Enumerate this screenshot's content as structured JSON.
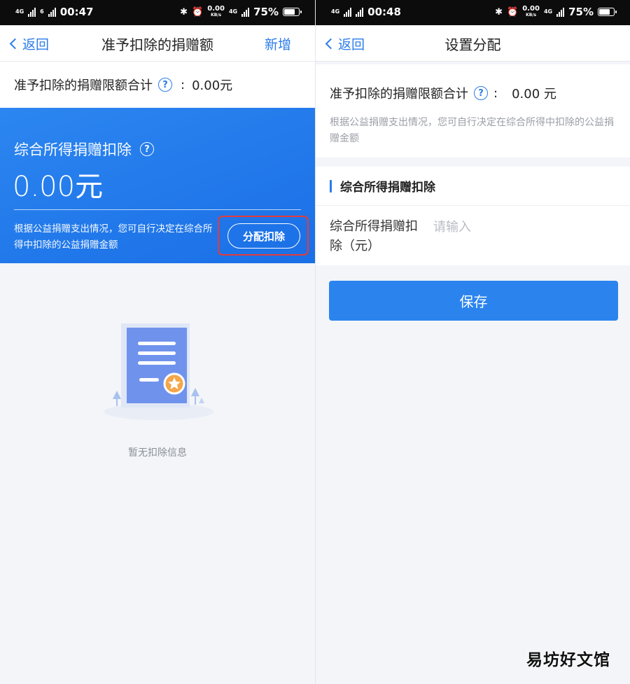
{
  "left": {
    "status": {
      "network_tag_a": "4G",
      "network_tag_b": "6",
      "time": "00:47",
      "speed": "0.00",
      "speed_unit": "KB/s",
      "network_tag_c": "4G",
      "battery": "75%",
      "battery_level": 0.75
    },
    "nav": {
      "back": "返回",
      "title": "准予扣除的捐赠额",
      "action": "新增"
    },
    "total": {
      "label": "准予扣除的捐赠限额合计",
      "colon": ":",
      "value": "0.00元"
    },
    "card": {
      "label": "综合所得捐赠扣除",
      "amount": "0.00元",
      "desc": "根据公益捐赠支出情况，您可自行决定在综合所得中扣除的公益捐赠金额",
      "button": "分配扣除"
    },
    "empty": {
      "text": "暂无扣除信息"
    }
  },
  "right": {
    "status": {
      "network_tag_a": "4G",
      "time": "00:48",
      "speed": "0.00",
      "speed_unit": "KB/s",
      "network_tag_c": "4G",
      "battery": "75%",
      "battery_level": 0.75
    },
    "nav": {
      "back": "返回",
      "title": "设置分配"
    },
    "total": {
      "label": "准予扣除的捐赠限额合计",
      "colon": ":",
      "value": "0.00 元"
    },
    "desc": "根据公益捐赠支出情况，您可自行决定在综合所得中扣除的公益捐赠金额",
    "section_title": "综合所得捐赠扣除",
    "field": {
      "label": "综合所得捐赠扣除（元）",
      "placeholder": "请输入"
    },
    "save": "保存"
  },
  "watermark": "易坊好文馆",
  "colors": {
    "primary": "#2b7ce9",
    "card": "#1f76ea",
    "highlight": "#e43b3b"
  }
}
